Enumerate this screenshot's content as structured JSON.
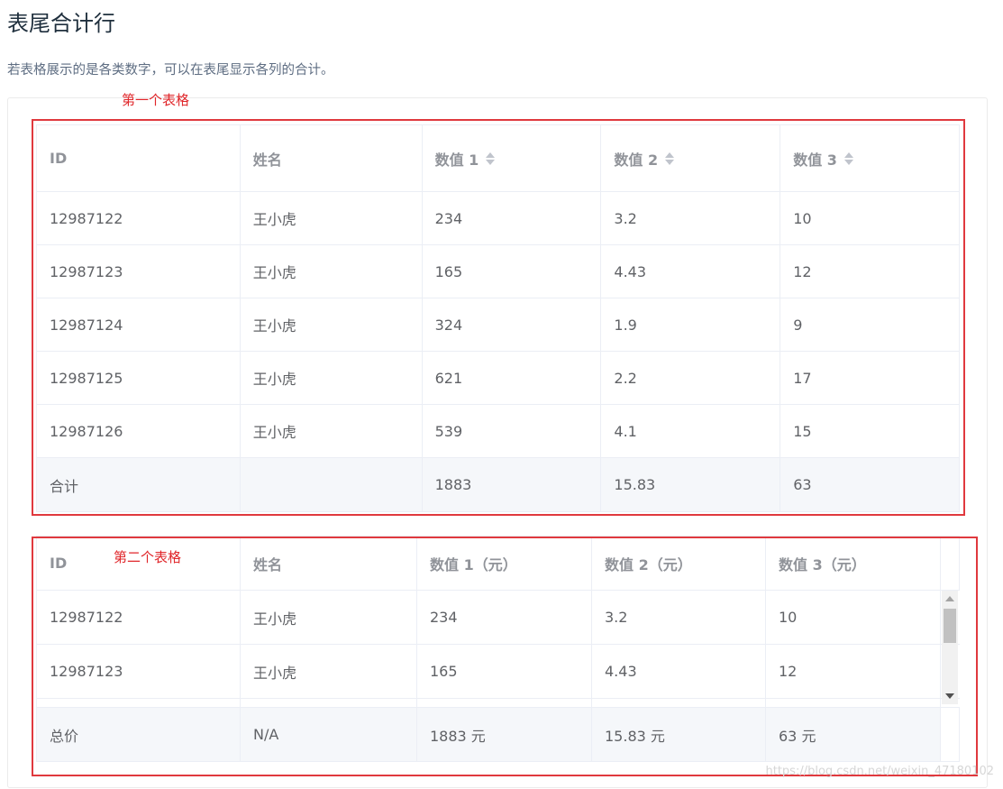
{
  "page": {
    "title": "表尾合计行",
    "description": "若表格展示的是各类数字，可以在表尾显示各列的合计。"
  },
  "annotations": {
    "first_table_label": "第一个表格",
    "second_table_label": "第二个表格"
  },
  "table1": {
    "headers": [
      "ID",
      "姓名",
      "数值 1",
      "数值 2",
      "数值 3"
    ],
    "rows": [
      [
        "12987122",
        "王小虎",
        "234",
        "3.2",
        "10"
      ],
      [
        "12987123",
        "王小虎",
        "165",
        "4.43",
        "12"
      ],
      [
        "12987124",
        "王小虎",
        "324",
        "1.9",
        "9"
      ],
      [
        "12987125",
        "王小虎",
        "621",
        "2.2",
        "17"
      ],
      [
        "12987126",
        "王小虎",
        "539",
        "4.1",
        "15"
      ]
    ],
    "footer": [
      "合计",
      "",
      "1883",
      "15.83",
      "63"
    ]
  },
  "table2": {
    "headers": [
      "ID",
      "姓名",
      "数值 1（元）",
      "数值 2（元）",
      "数值 3（元）"
    ],
    "rows": [
      [
        "12987122",
        "王小虎",
        "234",
        "3.2",
        "10"
      ],
      [
        "12987123",
        "王小虎",
        "165",
        "4.43",
        "12"
      ]
    ],
    "footer": [
      "总价",
      "N/A",
      "1883 元",
      "15.83 元",
      "63 元"
    ]
  },
  "watermark": "https://blog.csdn.net/weixin_47180102",
  "colors": {
    "annotation_red": "#e0393e",
    "header_text": "#909399",
    "footer_bg": "#f5f7fa"
  }
}
